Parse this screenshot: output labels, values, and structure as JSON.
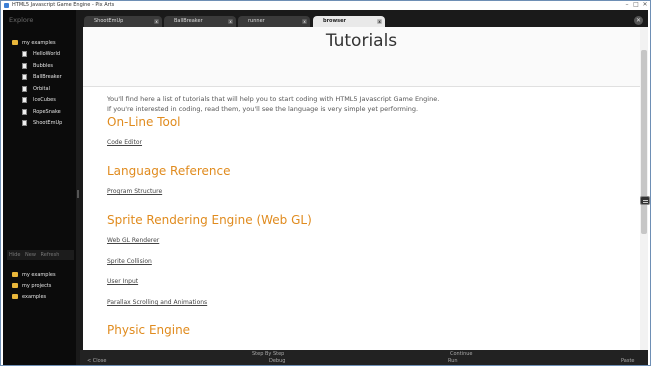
{
  "window": {
    "title": "HTML5 Javascript Game Engine - Pix Arts"
  },
  "explorer": {
    "title": "Explore",
    "root": "my examples",
    "items": [
      "HelloWorld",
      "Bubbles",
      "BallBreaker",
      "Orbital",
      "IceCubes",
      "RopeSnake",
      "ShootEmUp"
    ],
    "actions": [
      "Hide",
      "New",
      "Refresh"
    ],
    "folders": [
      "my examples",
      "my projects",
      "examples"
    ]
  },
  "tabs": [
    {
      "label": "ShootEmUp"
    },
    {
      "label": "BallBreaker"
    },
    {
      "label": "runner"
    },
    {
      "label": "browser"
    }
  ],
  "page": {
    "title": "Tutorials",
    "intro_line1": "You'll find here a list of tutorials that will help you to start coding with HTML5 Javascript Game Engine.",
    "intro_line2": "If you're interested in coding, read them, you'll see the language is very simple yet performing.",
    "sections": [
      {
        "title": "On-Line Tool",
        "links": [
          "Code Editor"
        ]
      },
      {
        "title": "Language Reference",
        "links": [
          "Program Structure"
        ]
      },
      {
        "title": "Sprite Rendering Engine (Web GL)",
        "links": [
          "Web GL Renderer",
          "Sprite Collision",
          "User Input",
          "Parallax Scrolling and Animations"
        ]
      },
      {
        "title": "Physic Engine",
        "links": []
      }
    ]
  },
  "bottom": {
    "step": "Step By Step",
    "continue": "Continue",
    "close": "< Close",
    "debug": "Debug",
    "run": "Run",
    "paste": "Paste"
  }
}
